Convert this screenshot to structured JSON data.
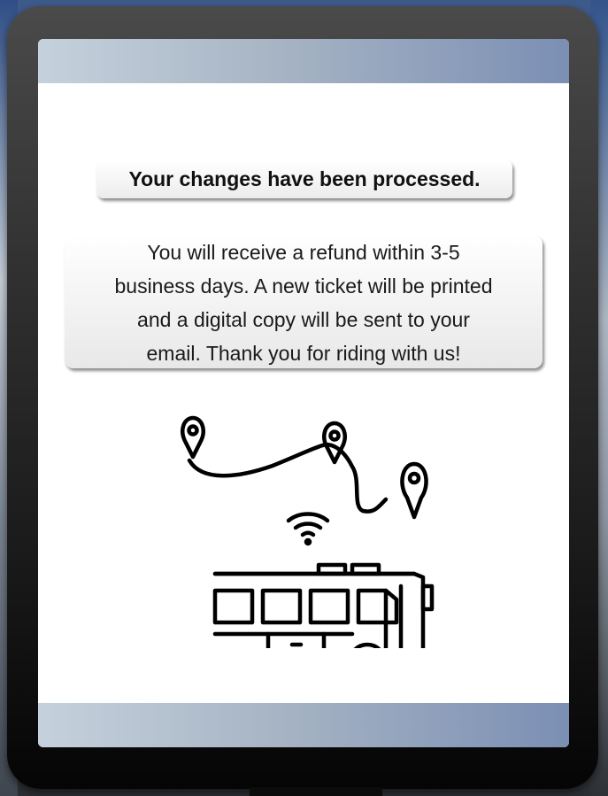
{
  "confirmation": {
    "headline": "Your changes have been processed.",
    "message_lines": [
      "You will receive a refund within 3-5",
      "business days. A new ticket will be printed",
      "and a digital copy will be sent to your",
      "email. Thank you for riding with us!"
    ]
  },
  "illustration": {
    "icons": [
      "location-pin-icon",
      "route-path-icon",
      "wifi-icon",
      "bus-icon"
    ]
  },
  "colors": {
    "kiosk_frame": "#2b2b2b",
    "screen_background": "#ffffff",
    "band_gradient_start": "#c5d1dc",
    "band_gradient_end": "#7b8fb4",
    "text": "#111111"
  }
}
